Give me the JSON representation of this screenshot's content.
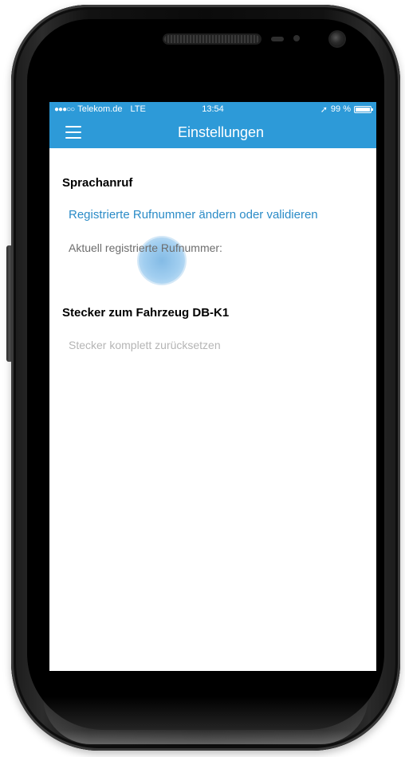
{
  "status_bar": {
    "signal": "●●●○○",
    "carrier": "Telekom.de",
    "network": "LTE",
    "time": "13:54",
    "location_arrow": "➚",
    "battery_text": "99 %",
    "battery_level": 0.99
  },
  "nav": {
    "title": "Einstellungen",
    "menu_icon": "hamburger-menu-icon"
  },
  "sections": {
    "voice_call": {
      "header": "Sprachanruf",
      "change_number_link": "Registrierte Rufnummer ändern oder validieren",
      "current_number_label": "Aktuell registrierte Rufnummer:"
    },
    "connector": {
      "header": "Stecker zum Fahrzeug DB-K1",
      "reset_label": "Stecker komplett zurücksetzen"
    }
  },
  "colors": {
    "accent": "#2d9ad8",
    "link": "#2a8bc7",
    "disabled": "#b5b5b5",
    "secondary_text": "#6d6d6d"
  }
}
